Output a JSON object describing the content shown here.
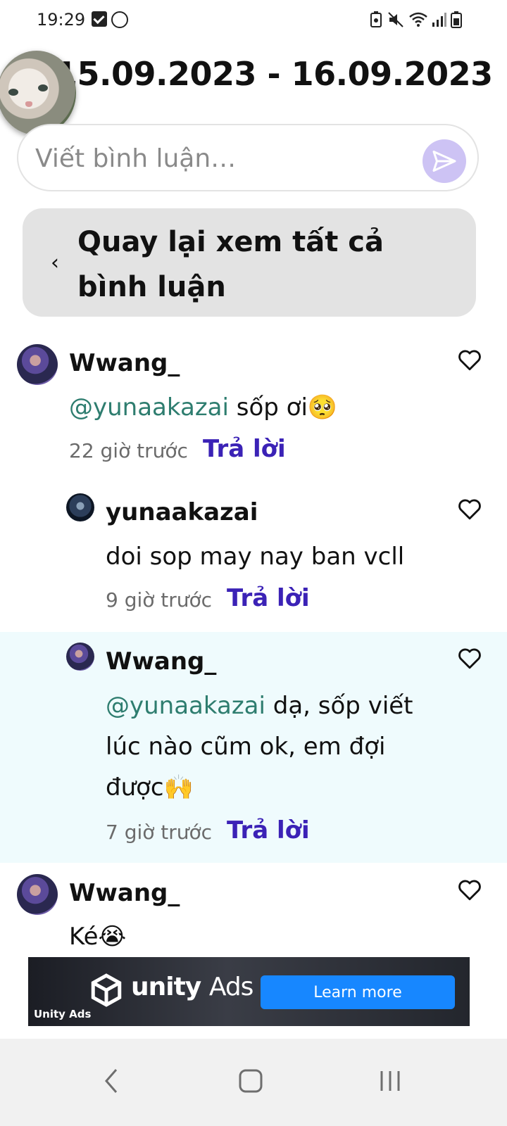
{
  "status_bar": {
    "time": "19:29"
  },
  "header": {
    "title": "15.09.2023 - 16.09.2023"
  },
  "comment_input": {
    "placeholder": "Viết bình luận…"
  },
  "back_button": {
    "label": "Quay lại xem tất cả bình luận"
  },
  "comments": [
    {
      "name": "Wwang_",
      "mention": "@yunaakazai",
      "text": " sốp ơi🥺",
      "time": "22 giờ trước",
      "reply_label": "Trả lời"
    },
    {
      "name": "yunaakazai",
      "mention": "",
      "text": "doi  sop may nay ban vcll",
      "time": "9 giờ trước",
      "reply_label": "Trả lời"
    },
    {
      "name": "Wwang_",
      "mention": "@yunaakazai",
      "text": " dạ, sốp viết lúc nào cũm ok, em đợi được🙌",
      "time": "7 giờ trước",
      "reply_label": "Trả lời"
    },
    {
      "name": "Wwang_",
      "mention": "",
      "text": "Ké😭",
      "time": "",
      "reply_label": ""
    }
  ],
  "ad": {
    "brand": "unity",
    "brand_suffix": "Ads",
    "small_brand": "Unity Ads",
    "cta": "Learn more"
  },
  "colors": {
    "accent": "#3b22b6",
    "mention": "#2e7d6f",
    "highlight_bg": "#effbfd",
    "send_button": "#cdc3f4"
  }
}
